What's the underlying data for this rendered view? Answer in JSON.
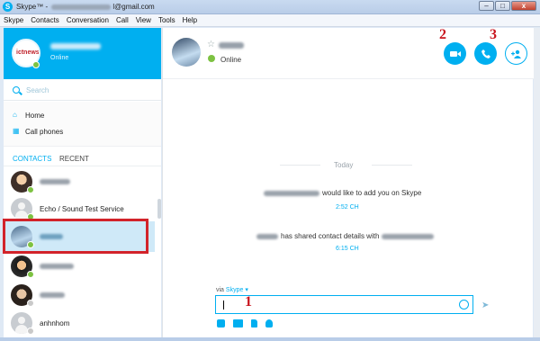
{
  "window": {
    "title_prefix": "Skype™ -",
    "title_suffix": "l@gmail.com",
    "buttons": {
      "minimize": "–",
      "maximize": "□",
      "close": "x"
    }
  },
  "menu": [
    "Skype",
    "Contacts",
    "Conversation",
    "Call",
    "View",
    "Tools",
    "Help"
  ],
  "profile": {
    "status": "Online",
    "logo_text": "ictnews"
  },
  "search": {
    "placeholder": "Search"
  },
  "nav": {
    "home": "Home",
    "call_phones": "Call phones"
  },
  "tabs": {
    "contacts": "CONTACTS",
    "recent": "RECENT"
  },
  "contacts": [
    {
      "name": "chinh ngo"
    },
    {
      "name": "Echo / Sound Test Service"
    },
    {
      "name": "Ka blin"
    },
    {
      "name": "thenhcong"
    },
    {
      "name": "altovall"
    },
    {
      "name": "anhnhom"
    }
  ],
  "conversation": {
    "status": "Online",
    "day_label": "Today",
    "messages": [
      {
        "text": "would like to add you on Skype",
        "time": "2:52 CH"
      },
      {
        "text": "has shared contact details with",
        "time": "6:15 CH"
      }
    ],
    "via_label": "via",
    "via_service": "Skype"
  },
  "annotations": {
    "one": "1",
    "two": "2",
    "three": "3"
  },
  "colors": {
    "accent": "#00aff0",
    "online": "#7dc242",
    "annotation": "#d2232a"
  },
  "icons": [
    "video-call-icon",
    "audio-call-icon",
    "add-participant-icon",
    "search-icon",
    "home-icon",
    "call-phones-icon",
    "emoticon-icon",
    "send-icon",
    "camera-icon",
    "video-message-icon",
    "send-file-icon",
    "send-contact-icon"
  ]
}
